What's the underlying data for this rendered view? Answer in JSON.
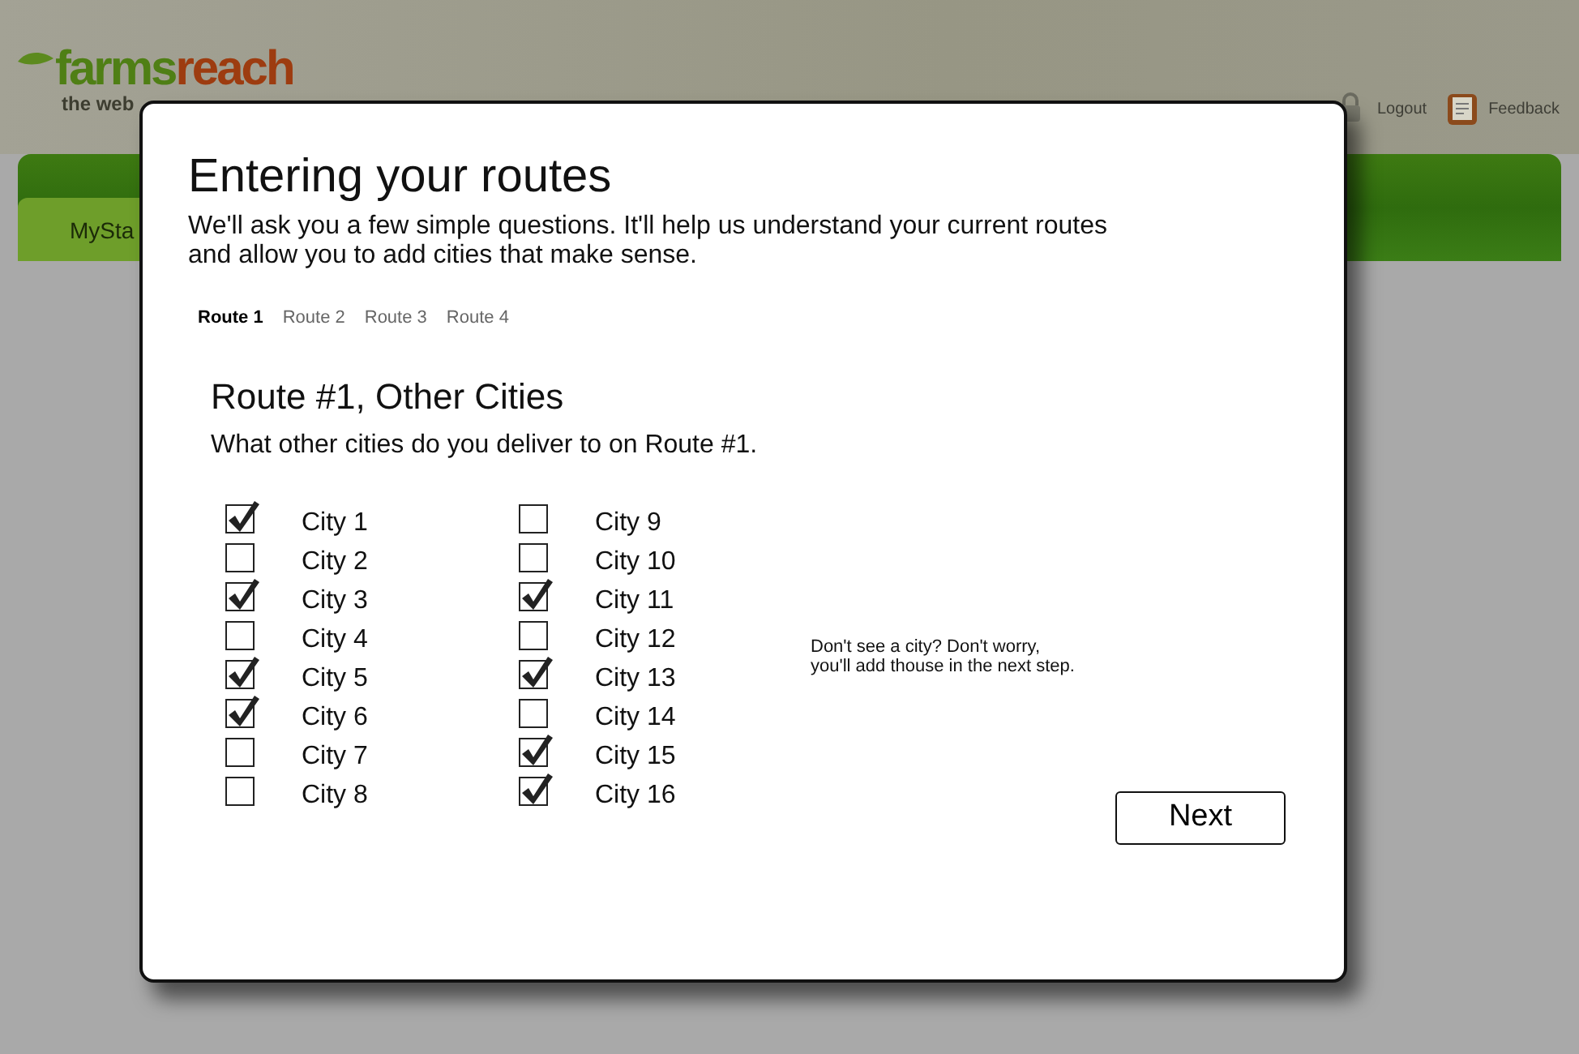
{
  "site": {
    "logo_left": "farms",
    "logo_right": "reach",
    "tagline": "the web",
    "nav_tab": "MySta",
    "links": [
      "Logout",
      "Feedback"
    ]
  },
  "dialog": {
    "title": "Entering your routes",
    "intro": "We'll ask you a few simple questions. It'll help us understand your current routes and allow you to add cities that make sense.",
    "tabs": [
      {
        "label": "Route 1",
        "selected": true
      },
      {
        "label": "Route 2",
        "selected": false
      },
      {
        "label": "Route 3",
        "selected": false
      },
      {
        "label": "Route 4",
        "selected": false
      }
    ],
    "heading": "Route #1, Other Cities",
    "question": "What other cities do you deliver to on Route #1.",
    "columns": [
      [
        {
          "label": "City 1",
          "checked": true
        },
        {
          "label": "City 2",
          "checked": false
        },
        {
          "label": "City 3",
          "checked": true
        },
        {
          "label": "City 4",
          "checked": false
        },
        {
          "label": "City 5",
          "checked": true
        },
        {
          "label": "City 6",
          "checked": true
        },
        {
          "label": "City 7",
          "checked": false
        },
        {
          "label": "City 8",
          "checked": false
        }
      ],
      [
        {
          "label": "City 9",
          "checked": false
        },
        {
          "label": "City 10",
          "checked": false
        },
        {
          "label": "City 11",
          "checked": true
        },
        {
          "label": "City 12",
          "checked": false
        },
        {
          "label": "City 13",
          "checked": true
        },
        {
          "label": "City 14",
          "checked": false
        },
        {
          "label": "City 15",
          "checked": true
        },
        {
          "label": "City 16",
          "checked": true
        }
      ]
    ],
    "note_lines": [
      "Don't see a city? Don't worry,",
      "you'll add thouse in the next step."
    ],
    "button": "Next"
  }
}
